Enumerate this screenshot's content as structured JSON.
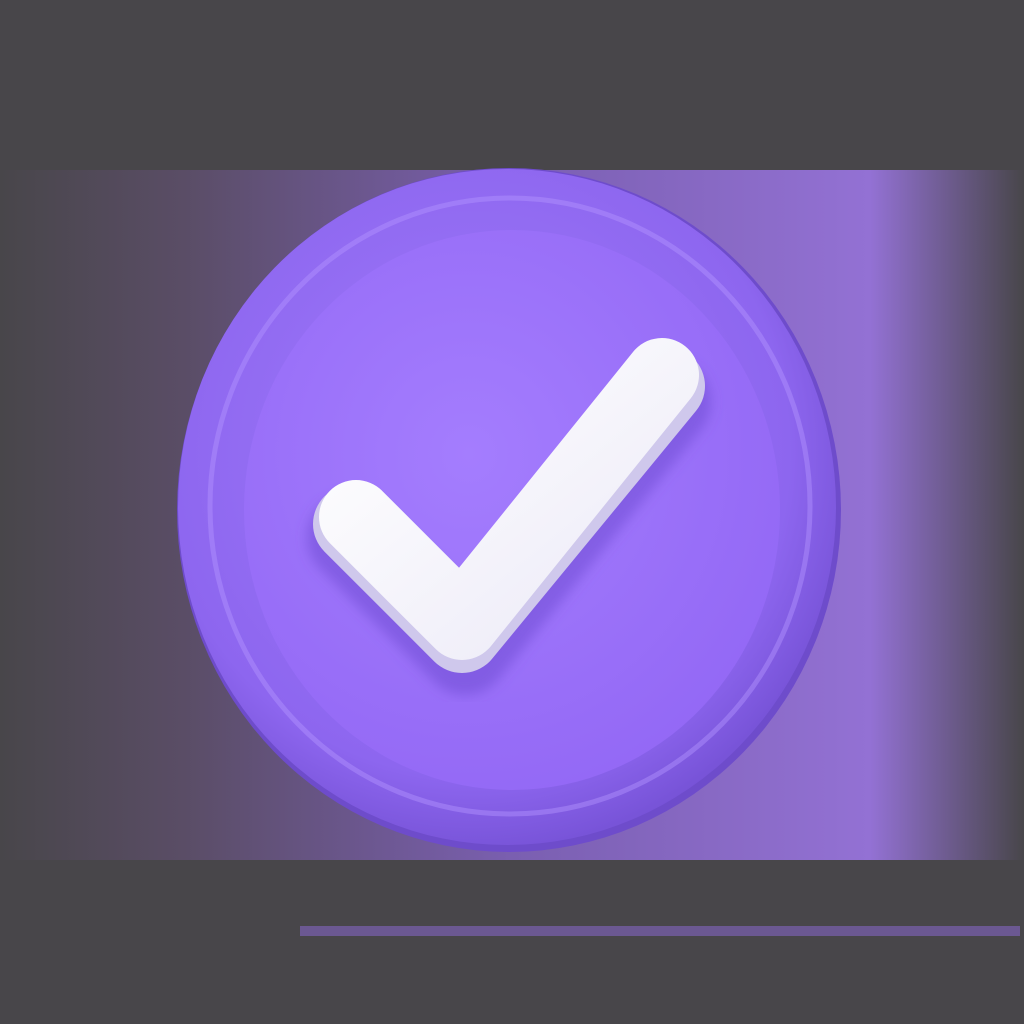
{
  "icon": {
    "name": "check-badge-icon",
    "semantic": "checkmark"
  },
  "colors": {
    "background": "#48464a",
    "background_purple": "#8a63c6",
    "badge_rim": "#8f68ee",
    "badge_face": "#9c70fb",
    "badge_shadow": "#6f4fc8",
    "check": "#ffffff",
    "check_shadow": "#c9c4e8"
  }
}
